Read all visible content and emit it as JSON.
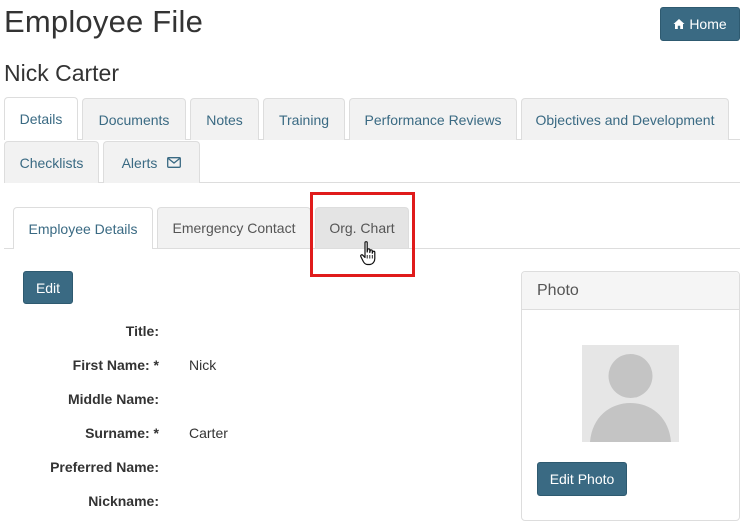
{
  "header": {
    "title": "Employee File",
    "home_label": "Home",
    "employee_name": "Nick Carter"
  },
  "main_tabs": [
    {
      "label": "Details",
      "active": true
    },
    {
      "label": "Documents"
    },
    {
      "label": "Notes"
    },
    {
      "label": "Training"
    },
    {
      "label": "Performance Reviews"
    },
    {
      "label": "Objectives and Development"
    },
    {
      "label": "Checklists"
    },
    {
      "label": "Alerts",
      "icon": "envelope-icon"
    }
  ],
  "sub_tabs": [
    {
      "label": "Employee Details",
      "active": true
    },
    {
      "label": "Emergency Contact"
    },
    {
      "label": "Org. Chart",
      "highlighted": true
    }
  ],
  "details": {
    "edit_label": "Edit",
    "fields": [
      {
        "label": "Title:",
        "value": ""
      },
      {
        "label": "First Name: *",
        "value": "Nick"
      },
      {
        "label": "Middle Name:",
        "value": ""
      },
      {
        "label": "Surname: *",
        "value": "Carter"
      },
      {
        "label": "Preferred Name:",
        "value": ""
      },
      {
        "label": "Nickname:",
        "value": ""
      }
    ]
  },
  "photo": {
    "heading": "Photo",
    "edit_photo_label": "Edit Photo"
  },
  "colors": {
    "accent": "#3a6a83",
    "highlight": "#e01b1b"
  }
}
